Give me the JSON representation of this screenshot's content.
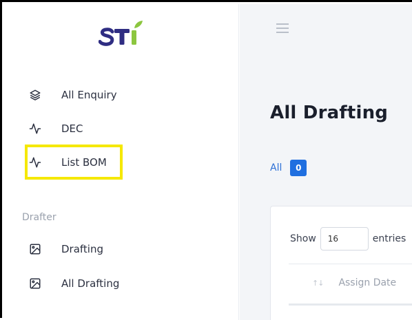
{
  "brand": {
    "logo_text": "STI",
    "colors": {
      "navy": "#2f2d82",
      "green": "#8cc63f"
    }
  },
  "sidebar": {
    "items": [
      {
        "label": "All Enquiry",
        "icon": "layers-icon"
      },
      {
        "label": "DEC",
        "icon": "activity-icon"
      },
      {
        "label": "List BOM",
        "icon": "activity-icon"
      }
    ],
    "section_title": "Drafter",
    "drafter_items": [
      {
        "label": "Drafting",
        "icon": "image-icon"
      },
      {
        "label": "All Drafting",
        "icon": "image-icon"
      }
    ]
  },
  "header": {
    "menu_icon": "hamburger-icon"
  },
  "main": {
    "title": "All Drafting",
    "filter": {
      "label": "All",
      "count": "0"
    },
    "table": {
      "show_label": "Show",
      "entries_value": "16",
      "entries_label": "entries",
      "columns": [
        "Assign Date"
      ],
      "sort_icon": "sort-icon"
    }
  },
  "accent_color": "#1f6fe0",
  "highlight_color": "#f5e800"
}
